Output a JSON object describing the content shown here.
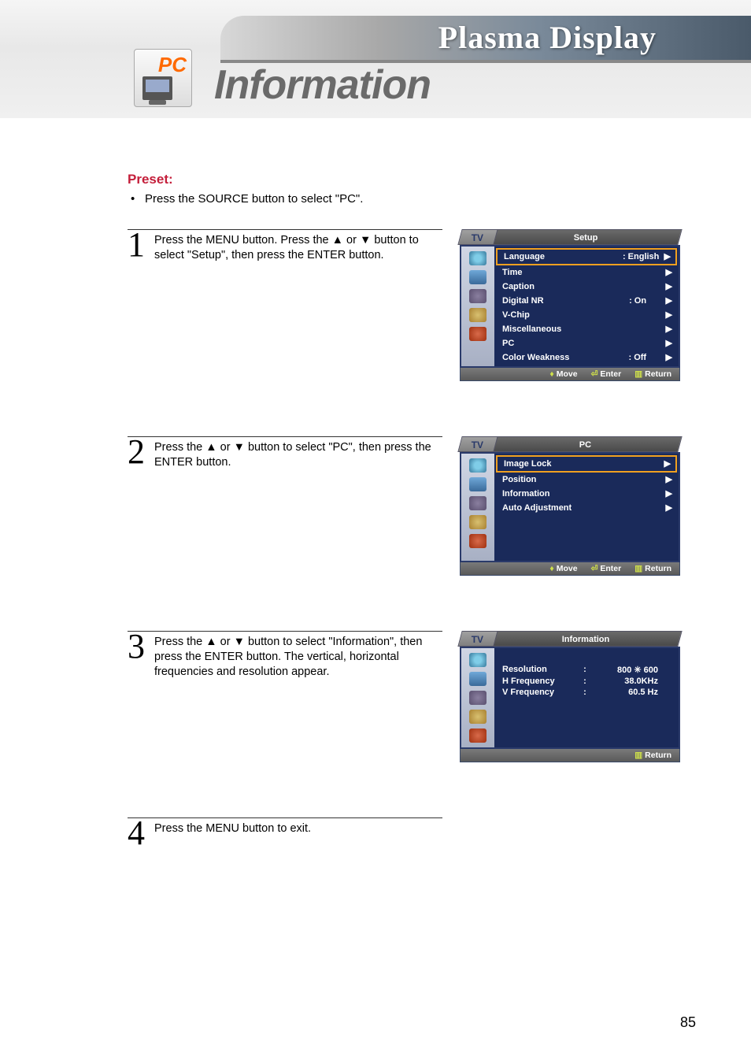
{
  "banner": {
    "brand": "Plasma Display",
    "badge": "PC",
    "title": "Information"
  },
  "preset": {
    "heading": "Preset:",
    "line": "Press the SOURCE button to select \"PC\"."
  },
  "steps": {
    "s1": {
      "num": "1",
      "text": "Press the MENU button. Press the ▲ or ▼ button to select \"Setup\", then press the ENTER button."
    },
    "s2": {
      "num": "2",
      "text": "Press the ▲ or ▼ button to select \"PC\", then press the ENTER button."
    },
    "s3": {
      "num": "3",
      "text": "Press the ▲ or ▼ button to select \"Information\", then press the ENTER button. The vertical, horizontal frequencies and resolution appear."
    },
    "s4": {
      "num": "4",
      "text": "Press the MENU button to exit."
    }
  },
  "osd": {
    "tv": "TV",
    "footer": {
      "move": "Move",
      "enter": "Enter",
      "return": "Return"
    },
    "setup": {
      "title": "Setup",
      "rows": {
        "language": {
          "label": "Language",
          "value": ":  English"
        },
        "time": {
          "label": "Time"
        },
        "caption": {
          "label": "Caption"
        },
        "dnr": {
          "label": "Digital NR",
          "value": ":  On"
        },
        "vchip": {
          "label": "V-Chip"
        },
        "misc": {
          "label": "Miscellaneous"
        },
        "pc": {
          "label": "PC"
        },
        "cw": {
          "label": "Color Weakness",
          "value": ":  Off"
        }
      }
    },
    "pc": {
      "title": "PC",
      "rows": {
        "imglock": {
          "label": "Image Lock"
        },
        "pos": {
          "label": "Position"
        },
        "info": {
          "label": "Information"
        },
        "auto": {
          "label": "Auto Adjustment"
        }
      }
    },
    "info": {
      "title": "Information",
      "rows": {
        "res": {
          "label": "Resolution",
          "value": "800 ✳ 600"
        },
        "hfrq": {
          "label": "H Frequency",
          "value": "38.0KHz"
        },
        "vfrq": {
          "label": "V Frequency",
          "value": "60.5 Hz"
        }
      }
    }
  },
  "page_number": "85"
}
